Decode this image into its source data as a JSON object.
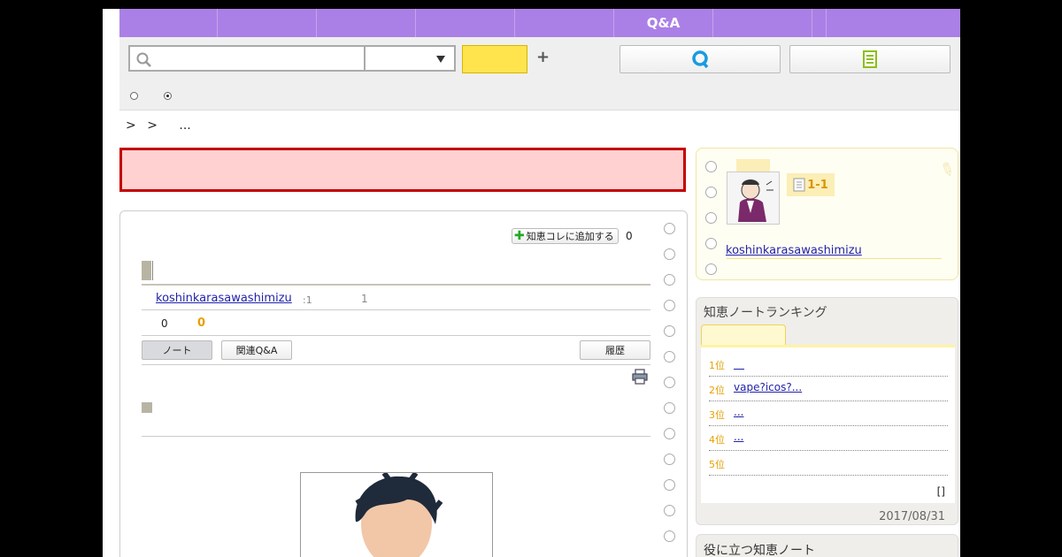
{
  "colors": {
    "tab_bg": "#ab80e6",
    "search_btn": "#ffe44d",
    "alert_bg": "#ffd1d1",
    "alert_border": "#c40000",
    "accent_orange": "#e6a000",
    "link": "#2222aa"
  },
  "tabs": [
    "",
    "",
    "",
    "",
    "",
    "Q&A",
    "",
    "",
    ""
  ],
  "search": {
    "value": "",
    "placeholder": "",
    "select_value": "",
    "button_label": "",
    "plus_label": "+",
    "search_icon": "search-icon",
    "q_icon": "q-logo-icon",
    "note_icon": "note-icon"
  },
  "radios": [
    {
      "selected": false
    },
    {
      "selected": true
    }
  ],
  "breadcrumb": [
    ">",
    ">",
    "..."
  ],
  "alert": {
    "link_text": ""
  },
  "note": {
    "add_button": "知恵コレに追加する",
    "add_count": "0",
    "author": "koshinkarasawashimizu",
    "meta1": ":1",
    "meta2": "1",
    "count_view": "0",
    "count_orange": "0",
    "tab_note": "ノート",
    "tab_related": "関連Q&A",
    "tab_history": "履歴"
  },
  "profile": {
    "badge": "1-1",
    "name": "koshinkarasawashimizu"
  },
  "ranking": {
    "title": "知恵ノートランキング",
    "items": [
      {
        "no": "1位",
        "text": "＿"
      },
      {
        "no": "2位",
        "text": "vape?icos?... "
      },
      {
        "no": "3位",
        "text": "... "
      },
      {
        "no": "4位",
        "text": "...  "
      },
      {
        "no": "5位",
        "text": ""
      }
    ],
    "more": "[]",
    "date": "2017/08/31"
  },
  "useful": {
    "title": "役に立つ知恵ノート"
  }
}
